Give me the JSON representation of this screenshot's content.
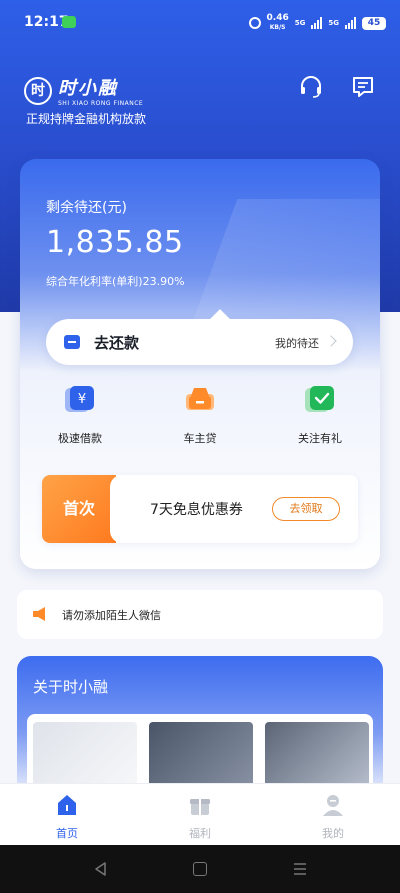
{
  "status_bar": {
    "time": "12:17",
    "net_speed": "0.46",
    "net_unit": "KB/S",
    "signal_1": "5G",
    "signal_2": "5G",
    "battery": "45"
  },
  "brand": {
    "logo_glyph": "时",
    "name_cn": "时小融",
    "name_en": "SHI XIAO RONG FINANCE",
    "slogan": "正规持牌金融机构放款"
  },
  "header_icons": [
    "headset-icon",
    "message-icon"
  ],
  "loan_card": {
    "remain_label": "剩余待还(元)",
    "remain_amount": "1,835.85",
    "rate_text": "综合年化利率(单利)23.90%",
    "repay_label": "去还款",
    "my_repay_link": "我的待还"
  },
  "quick_actions": [
    {
      "label": "极速借款",
      "icon": "yuan-card-icon",
      "color": "#2f62ea"
    },
    {
      "label": "车主贷",
      "icon": "car-icon",
      "color": "#ff8a2a"
    },
    {
      "label": "关注有礼",
      "icon": "wechat-check-icon",
      "color": "#22b85a"
    }
  ],
  "coupon": {
    "badge": "首次",
    "text": "7天免息优惠券",
    "claim_button": "去领取"
  },
  "notice": {
    "text": "请勿添加陌生人微信"
  },
  "about": {
    "title": "关于时小融"
  },
  "tabbar": {
    "items": [
      {
        "label": "首页",
        "active": true
      },
      {
        "label": "福利",
        "active": false
      },
      {
        "label": "我的",
        "active": false
      }
    ]
  },
  "colors": {
    "primary": "#2f62ea",
    "accent_orange": "#ff8a2a",
    "accent_green": "#22b85a"
  }
}
